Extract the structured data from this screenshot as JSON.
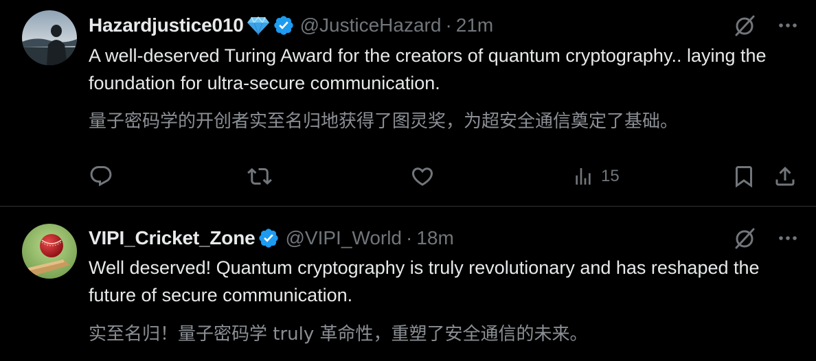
{
  "colors": {
    "background": "#000000",
    "text_primary": "#e7e9ea",
    "text_secondary": "#71767b",
    "translation_text": "#8b8f94",
    "divider": "#2f3336",
    "verified_blue": "#1d9bf0",
    "diamond_blue": "#4ab4f0"
  },
  "tweets": [
    {
      "display_name": "Hazardjustice010",
      "name_emoji_icon": "gem-icon",
      "verified_icon": "verified-badge-icon",
      "handle": "@JusticeHazard",
      "separator": "·",
      "time": "21m",
      "text": "A well-deserved Turing Award for the creators of quantum cryptography.. laying the foundation for ultra-secure communication.",
      "translation": "量子密码学的开创者实至名归地获得了图灵奖，为超安全通信奠定了基础。",
      "actions": {
        "reply_icon": "reply-icon",
        "retweet_icon": "retweet-icon",
        "like_icon": "heart-icon",
        "views_icon": "views-chart-icon",
        "views_count": "15",
        "bookmark_icon": "bookmark-icon",
        "share_icon": "share-icon"
      }
    },
    {
      "display_name": "VIPI_Cricket_Zone",
      "verified_icon": "verified-badge-icon",
      "handle": "@VIPI_World",
      "separator": "·",
      "time": "18m",
      "text": "Well deserved! Quantum cryptography is truly revolutionary and has reshaped the future of secure communication.",
      "translation": "实至名归！量子密码学 truly 革命性，重塑了安全通信的未来。"
    }
  ]
}
